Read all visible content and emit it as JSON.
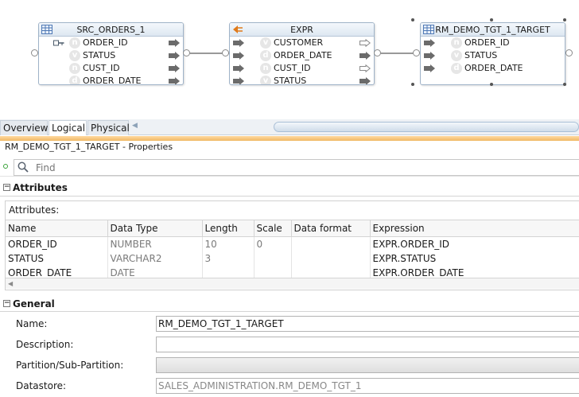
{
  "diagram": {
    "nodes": [
      {
        "id": "src",
        "title": "SRC_ORDERS_1",
        "rows": [
          {
            "label": "ORDER_ID",
            "badge": "n"
          },
          {
            "label": "STATUS",
            "badge": "v"
          },
          {
            "label": "CUST_ID",
            "badge": "n"
          },
          {
            "label": "ORDER_DATE",
            "badge": "d"
          }
        ]
      },
      {
        "id": "expr",
        "title": "EXPR",
        "rows": [
          {
            "label": "CUSTOMER",
            "badge": "v"
          },
          {
            "label": "ORDER_DATE",
            "badge": "d"
          },
          {
            "label": "CUST_ID",
            "badge": "n"
          },
          {
            "label": "STATUS",
            "badge": "v"
          }
        ]
      },
      {
        "id": "tgt",
        "title": "RM_DEMO_TGT_1_TARGET",
        "rows": [
          {
            "label": "ORDER_ID",
            "badge": "n"
          },
          {
            "label": "STATUS",
            "badge": "v"
          },
          {
            "label": "ORDER_DATE",
            "badge": "d"
          }
        ]
      }
    ]
  },
  "tabs": [
    {
      "label": "Overview",
      "active": false
    },
    {
      "label": "Logical",
      "active": true
    },
    {
      "label": "Physical",
      "active": false
    }
  ],
  "properties": {
    "title": "RM_DEMO_TGT_1_TARGET - Properties",
    "find_placeholder": "Find",
    "attributes_section": "Attributes",
    "attributes_caption": "Attributes:",
    "columns": [
      "Name",
      "Data Type",
      "Length",
      "Scale",
      "Data format",
      "Expression"
    ],
    "rows": [
      [
        "ORDER_ID",
        "NUMBER",
        "10",
        "0",
        "",
        "EXPR.ORDER_ID"
      ],
      [
        "STATUS",
        "VARCHAR2",
        "3",
        "",
        "",
        "EXPR.STATUS"
      ],
      [
        "ORDER_DATE",
        "DATE",
        "",
        "",
        "",
        "EXPR.ORDER_DATE"
      ]
    ],
    "general_section": "General",
    "general": {
      "name_label": "Name:",
      "name_value": "RM_DEMO_TGT_1_TARGET",
      "description_label": "Description:",
      "description_value": "",
      "partition_label": "Partition/Sub-Partition:",
      "partition_value": "",
      "datastore_label": "Datastore:",
      "datastore_value": "SALES_ADMINISTRATION.RM_DEMO_TGT_1"
    }
  },
  "colors": {
    "accent_orange": "#f0b965",
    "header_blue": "#dde7f1",
    "arrow_gray": "#6b6b6b"
  }
}
